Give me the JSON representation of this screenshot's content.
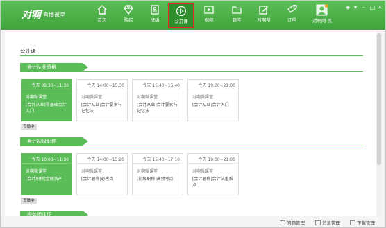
{
  "app": {
    "logo": "对啊",
    "logo_sub": "直播课堂"
  },
  "nav": [
    {
      "label": "首页",
      "icon": "home-icon"
    },
    {
      "label": "购买",
      "icon": "diamond-icon"
    },
    {
      "label": "班级",
      "icon": "class-icon"
    },
    {
      "label": "公开课",
      "icon": "play-icon",
      "active": true
    },
    {
      "label": "视频",
      "icon": "video-icon"
    },
    {
      "label": "题库",
      "icon": "folder-icon"
    },
    {
      "label": "对啊帮",
      "icon": "edit-icon"
    },
    {
      "label": "订单",
      "icon": "tag-icon"
    },
    {
      "label": "对啊网-凯",
      "icon": "avatar-icon"
    }
  ],
  "window_controls": {
    "wifi": "◈",
    "menu": "▾",
    "minimize": "–",
    "maximize": "□",
    "close": "✕"
  },
  "page": {
    "title": "公开课"
  },
  "sections": [
    {
      "title": "会计从业资格",
      "live_badge": "直播中",
      "cards": [
        {
          "time": "今天  09:30~11:30",
          "source": "对啊微课堂",
          "title": "[会计从业]零基础会计入门",
          "live": true
        },
        {
          "time": "今天  14:00~15:30",
          "source": "对啊微课堂",
          "title": "[会计从业]会计要素与记忆法",
          "live": false
        },
        {
          "time": "今天  15:40~16:40",
          "source": "对啊微课堂",
          "title": "[会计从业]会计要素与记忆法",
          "live": false
        },
        {
          "time": "今天  19:00~21:00",
          "source": "对啊微课堂",
          "title": "[会计从业]会计入门",
          "live": false
        }
      ]
    },
    {
      "title": "会计初级职称",
      "live_badge": "直播中",
      "cards": [
        {
          "time": "今天  10:00~11:30",
          "source": "对啊微课堂",
          "title": "[会计职称]金融资产",
          "live": true
        },
        {
          "time": "今天  14:00~15:20",
          "source": "对啊微课堂",
          "title": "[会计职称]必考点",
          "live": false
        },
        {
          "time": "今天  15:40~17:10",
          "source": "对啊微课堂",
          "title": "[初级职称]高频考点",
          "live": false
        },
        {
          "time": "今天  19:00~21:00",
          "source": "对啊微课堂",
          "title": "[会计职称]会计试重难点",
          "live": false
        }
      ]
    },
    {
      "title": "税务师认证"
    }
  ],
  "bottom": {
    "resource": "问题管理",
    "message": "消息管理",
    "download": "下载管理"
  },
  "colors": {
    "primary": "#5bbd57",
    "active_border": "#e02828"
  }
}
